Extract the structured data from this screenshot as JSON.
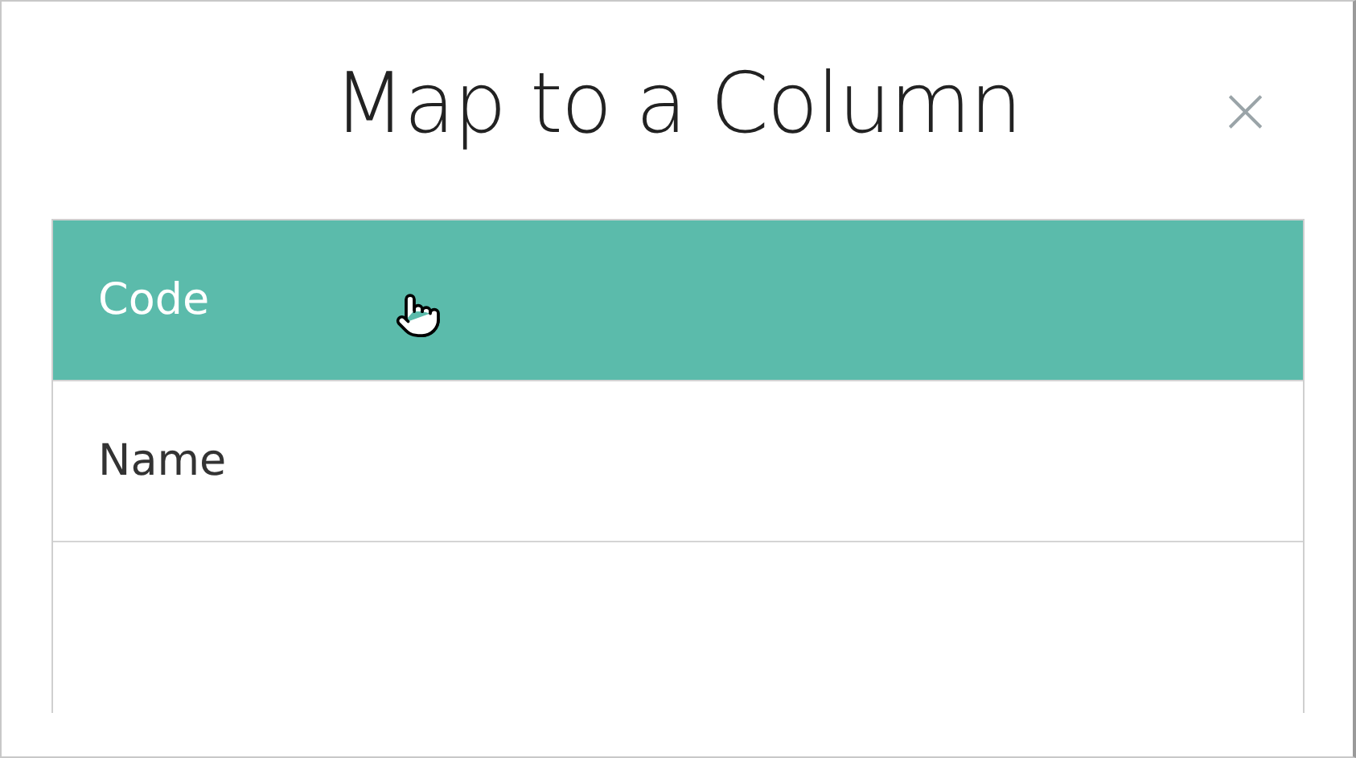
{
  "dialog": {
    "title": "Map to a Column",
    "close": "×"
  },
  "columns": [
    {
      "label": "Code",
      "selected": true
    },
    {
      "label": "Name",
      "selected": false
    }
  ]
}
